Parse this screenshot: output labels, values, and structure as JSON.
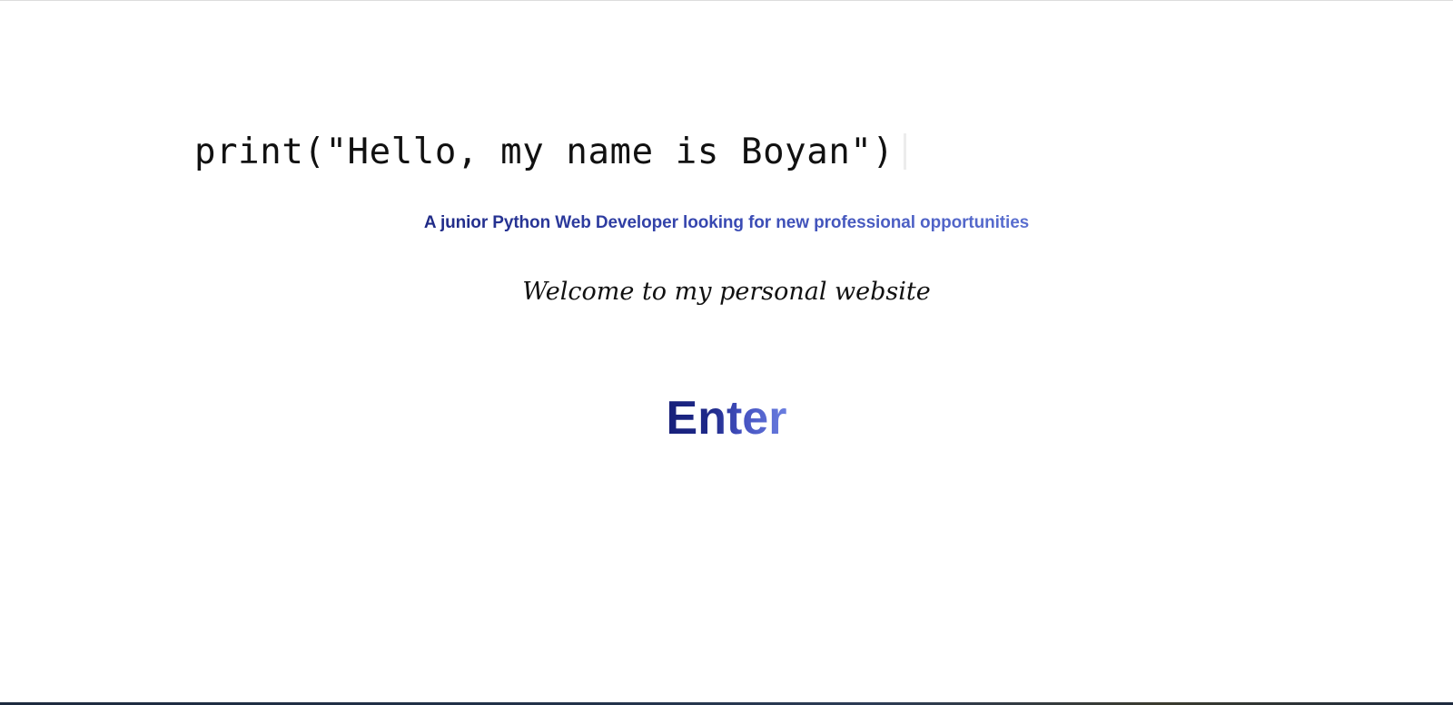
{
  "hero": {
    "code_line": "print(\"Hello, my name is Boyan\")",
    "subtitle": "A junior Python Web Developer looking for new professional opportunities",
    "welcome": "Welcome to my personal website",
    "enter_label": "Enter"
  },
  "colors": {
    "text": "#111111",
    "gradient_start": "#17207a",
    "gradient_end": "#6a7ee0",
    "background": "#ffffff"
  }
}
